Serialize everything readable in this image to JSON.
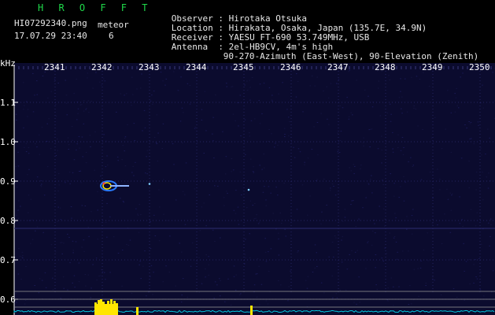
{
  "header": {
    "brand": "H R O F F T",
    "filename": "HI07292340.png",
    "datetime": "17.07.29 23:40",
    "meteor_label": "meteor",
    "meteor_count": "6",
    "info": [
      {
        "label": "Observer",
        "value": "Hirotaka Otsuka"
      },
      {
        "label": "Location",
        "value": "Hirakata, Osaka, Japan (135.7E, 34.9N)"
      },
      {
        "label": "Receiver",
        "value": "YAESU FT-690 53.749MHz, USB"
      },
      {
        "label": "Antenna ",
        "value": "2el-HB9CV, 4m's high"
      },
      {
        "label": "",
        "value": "90-270-Azimuth (East-West), 90-Elevation (Zenith)"
      }
    ]
  },
  "axis": {
    "y_unit": "kHz",
    "x_ticks": [
      "2341",
      "2342",
      "2343",
      "2344",
      "2345",
      "2346",
      "2347",
      "2348",
      "2349",
      "2350"
    ],
    "y_ticks": [
      "1.1",
      "1.0",
      "0.9",
      "0.8",
      "0.7",
      "0.6"
    ]
  },
  "colors": {
    "background": "#000000",
    "waterfall": "#0b0b2e",
    "grid_text": "#ffffff",
    "brand": "#1fd84a",
    "echo": "#ffe600",
    "noise": "#00c8e0"
  },
  "detections": [
    {
      "time_min": 2342.2,
      "freq_khz": 0.888,
      "kind": "meteor-echo"
    },
    {
      "time_min": 2343.0,
      "freq_khz": 0.893,
      "kind": "spot"
    },
    {
      "time_min": 2345.1,
      "freq_khz": 0.878,
      "kind": "spot"
    }
  ]
}
